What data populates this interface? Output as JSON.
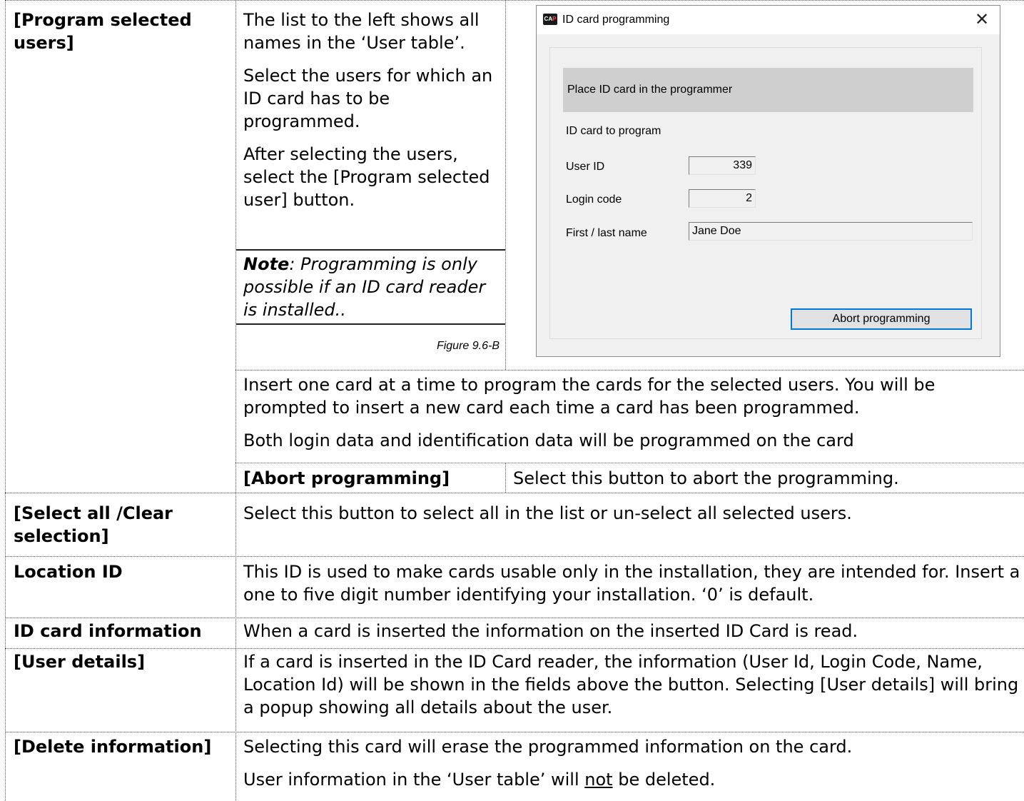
{
  "rows": {
    "program_selected": {
      "term": "[Program selected users]",
      "paragraphs": [
        "The list to the left shows all names in the ‘User table’.",
        "Select the users for which an ID card has to be programmed.",
        "After selecting the users, select the [Program selected user] button."
      ],
      "note_label": "Note",
      "note_text": ": Programming is only possible if an ID card reader is installed..",
      "figure_caption": "Figure 9.6-B",
      "after_paragraphs": [
        "Insert one card at a time to program the cards for the selected users. You will be prompted to insert a new card each time a card has been programmed.",
        "Both login data and identification data will be programmed on the card"
      ],
      "sub_term": "[Abort programming]",
      "sub_description": "Select this button to abort the programming."
    },
    "select_all": {
      "term": "[Select all /Clear selection]",
      "description": "Select this button to select all in the list or un-select all selected users."
    },
    "location_id": {
      "term": "Location ID",
      "description": "This ID is used to make cards usable only in the installation, they are intended for. Insert a one to five digit number identifying your installation. ‘0’ is default."
    },
    "id_card_info": {
      "term": "ID card information",
      "description": "When a card is inserted the information on the inserted ID Card is read."
    },
    "user_details": {
      "term": "[User details]",
      "description": "If a card is inserted in the ID Card reader, the information (User Id, Login Code, Name, Location Id) will be shown in the fields above the button. Selecting [User details] will bring a popup showing all details about the user."
    },
    "delete_info": {
      "term": "[Delete information]",
      "line1": "Selecting this card will erase the programmed information on the card.",
      "line2_before": "User information in the ‘User table’ will ",
      "line2_underlined": "not",
      "line2_after": " be deleted."
    }
  },
  "dialog": {
    "icon_text_a": "CA",
    "icon_text_b": "P",
    "title": "ID card programming",
    "close_glyph": "✕",
    "banner": "Place ID card in the programmer",
    "section_label": "ID card to program",
    "user_id_label": "User ID",
    "user_id_value": "339",
    "login_code_label": "Login code",
    "login_code_value": "2",
    "name_label": "First / last name",
    "name_value": "Jane Doe",
    "abort_button": "Abort programming"
  }
}
